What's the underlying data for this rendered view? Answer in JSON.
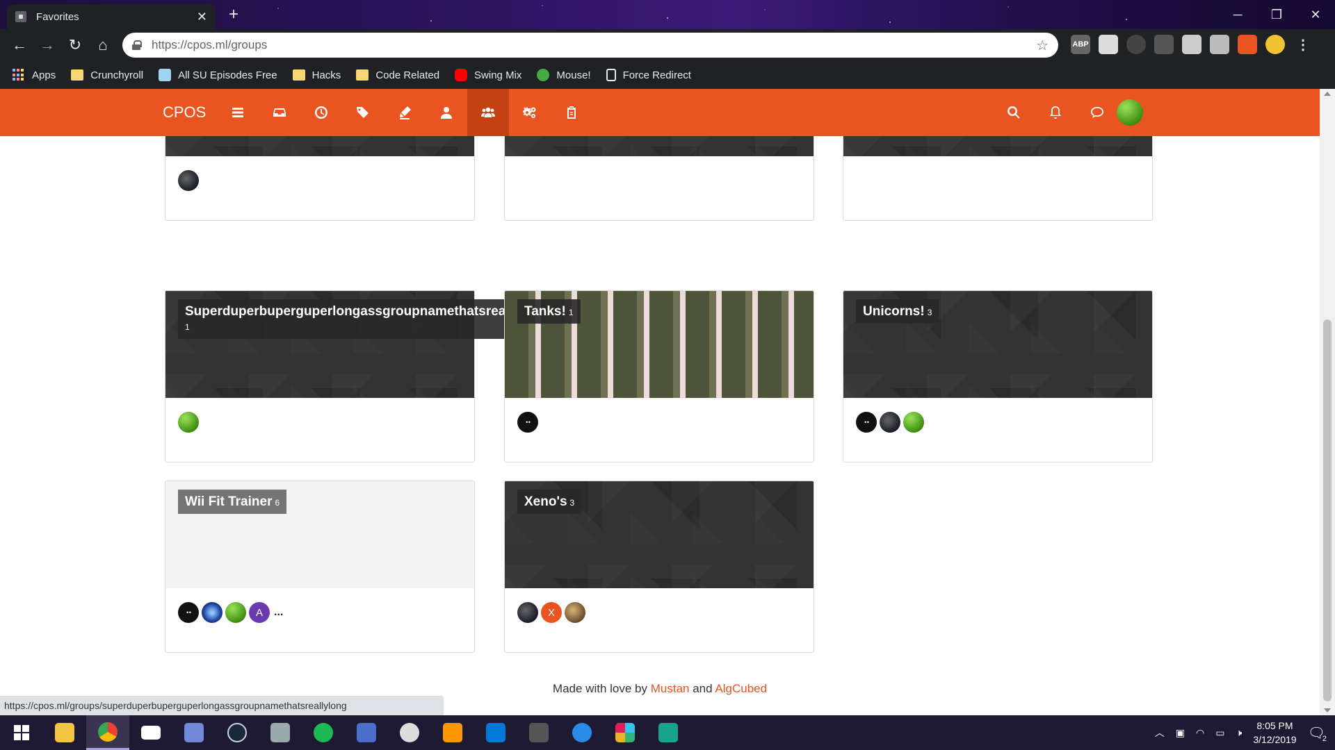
{
  "browser": {
    "tab_title": "Favorites",
    "url": "https://cpos.ml/groups",
    "bookmarks": [
      {
        "label": "Apps"
      },
      {
        "label": "Crunchyroll"
      },
      {
        "label": "All SU Episodes Free"
      },
      {
        "label": "Hacks"
      },
      {
        "label": "Code Related"
      },
      {
        "label": "Swing Mix"
      },
      {
        "label": "Mouse!"
      },
      {
        "label": "Force Redirect"
      }
    ],
    "status_url": "https://cpos.ml/groups/superduperbuperguperlongassgroupnamethatsreallylong"
  },
  "app": {
    "brand": "CPOS",
    "accent": "#e95420",
    "nav_icons": [
      "list-icon",
      "inbox-icon",
      "clock-icon",
      "tags-icon",
      "pen-icon",
      "user-icon",
      "groups-icon",
      "settings-icon",
      "clipboard-icon"
    ],
    "active_nav": "groups-icon",
    "right_icons": [
      "search-icon",
      "bell-icon",
      "chat-icon"
    ]
  },
  "groups": [
    {
      "name": "",
      "count": "",
      "members": [
        "dark"
      ]
    },
    {
      "name": "",
      "count": "",
      "members": []
    },
    {
      "name": "",
      "count": "",
      "members": []
    },
    {
      "name": "Superduperbuperguperlongassgroupnamethatsreallylong",
      "count": "1",
      "members": [
        "green"
      ]
    },
    {
      "name": "Tanks!",
      "count": "1",
      "members": [
        "black"
      ]
    },
    {
      "name": "Unicorns!",
      "count": "3",
      "members": [
        "black",
        "dark",
        "green"
      ]
    },
    {
      "name": "Wii Fit Trainer",
      "count": "6",
      "members": [
        "black",
        "blue",
        "green",
        "purple-A"
      ],
      "more": "..."
    },
    {
      "name": "Xeno's",
      "count": "3",
      "members": [
        "dark",
        "orange-X",
        "bronze"
      ]
    }
  ],
  "avatar_letters": {
    "purple-A": "A",
    "orange-X": "X"
  },
  "footer": {
    "prefix": "Made with love by",
    "author1": "Mustan",
    "and": "and",
    "author2": "AlgCubed"
  },
  "taskbar": {
    "time": "8:05 PM",
    "date": "3/12/2019",
    "notifications": "2"
  }
}
